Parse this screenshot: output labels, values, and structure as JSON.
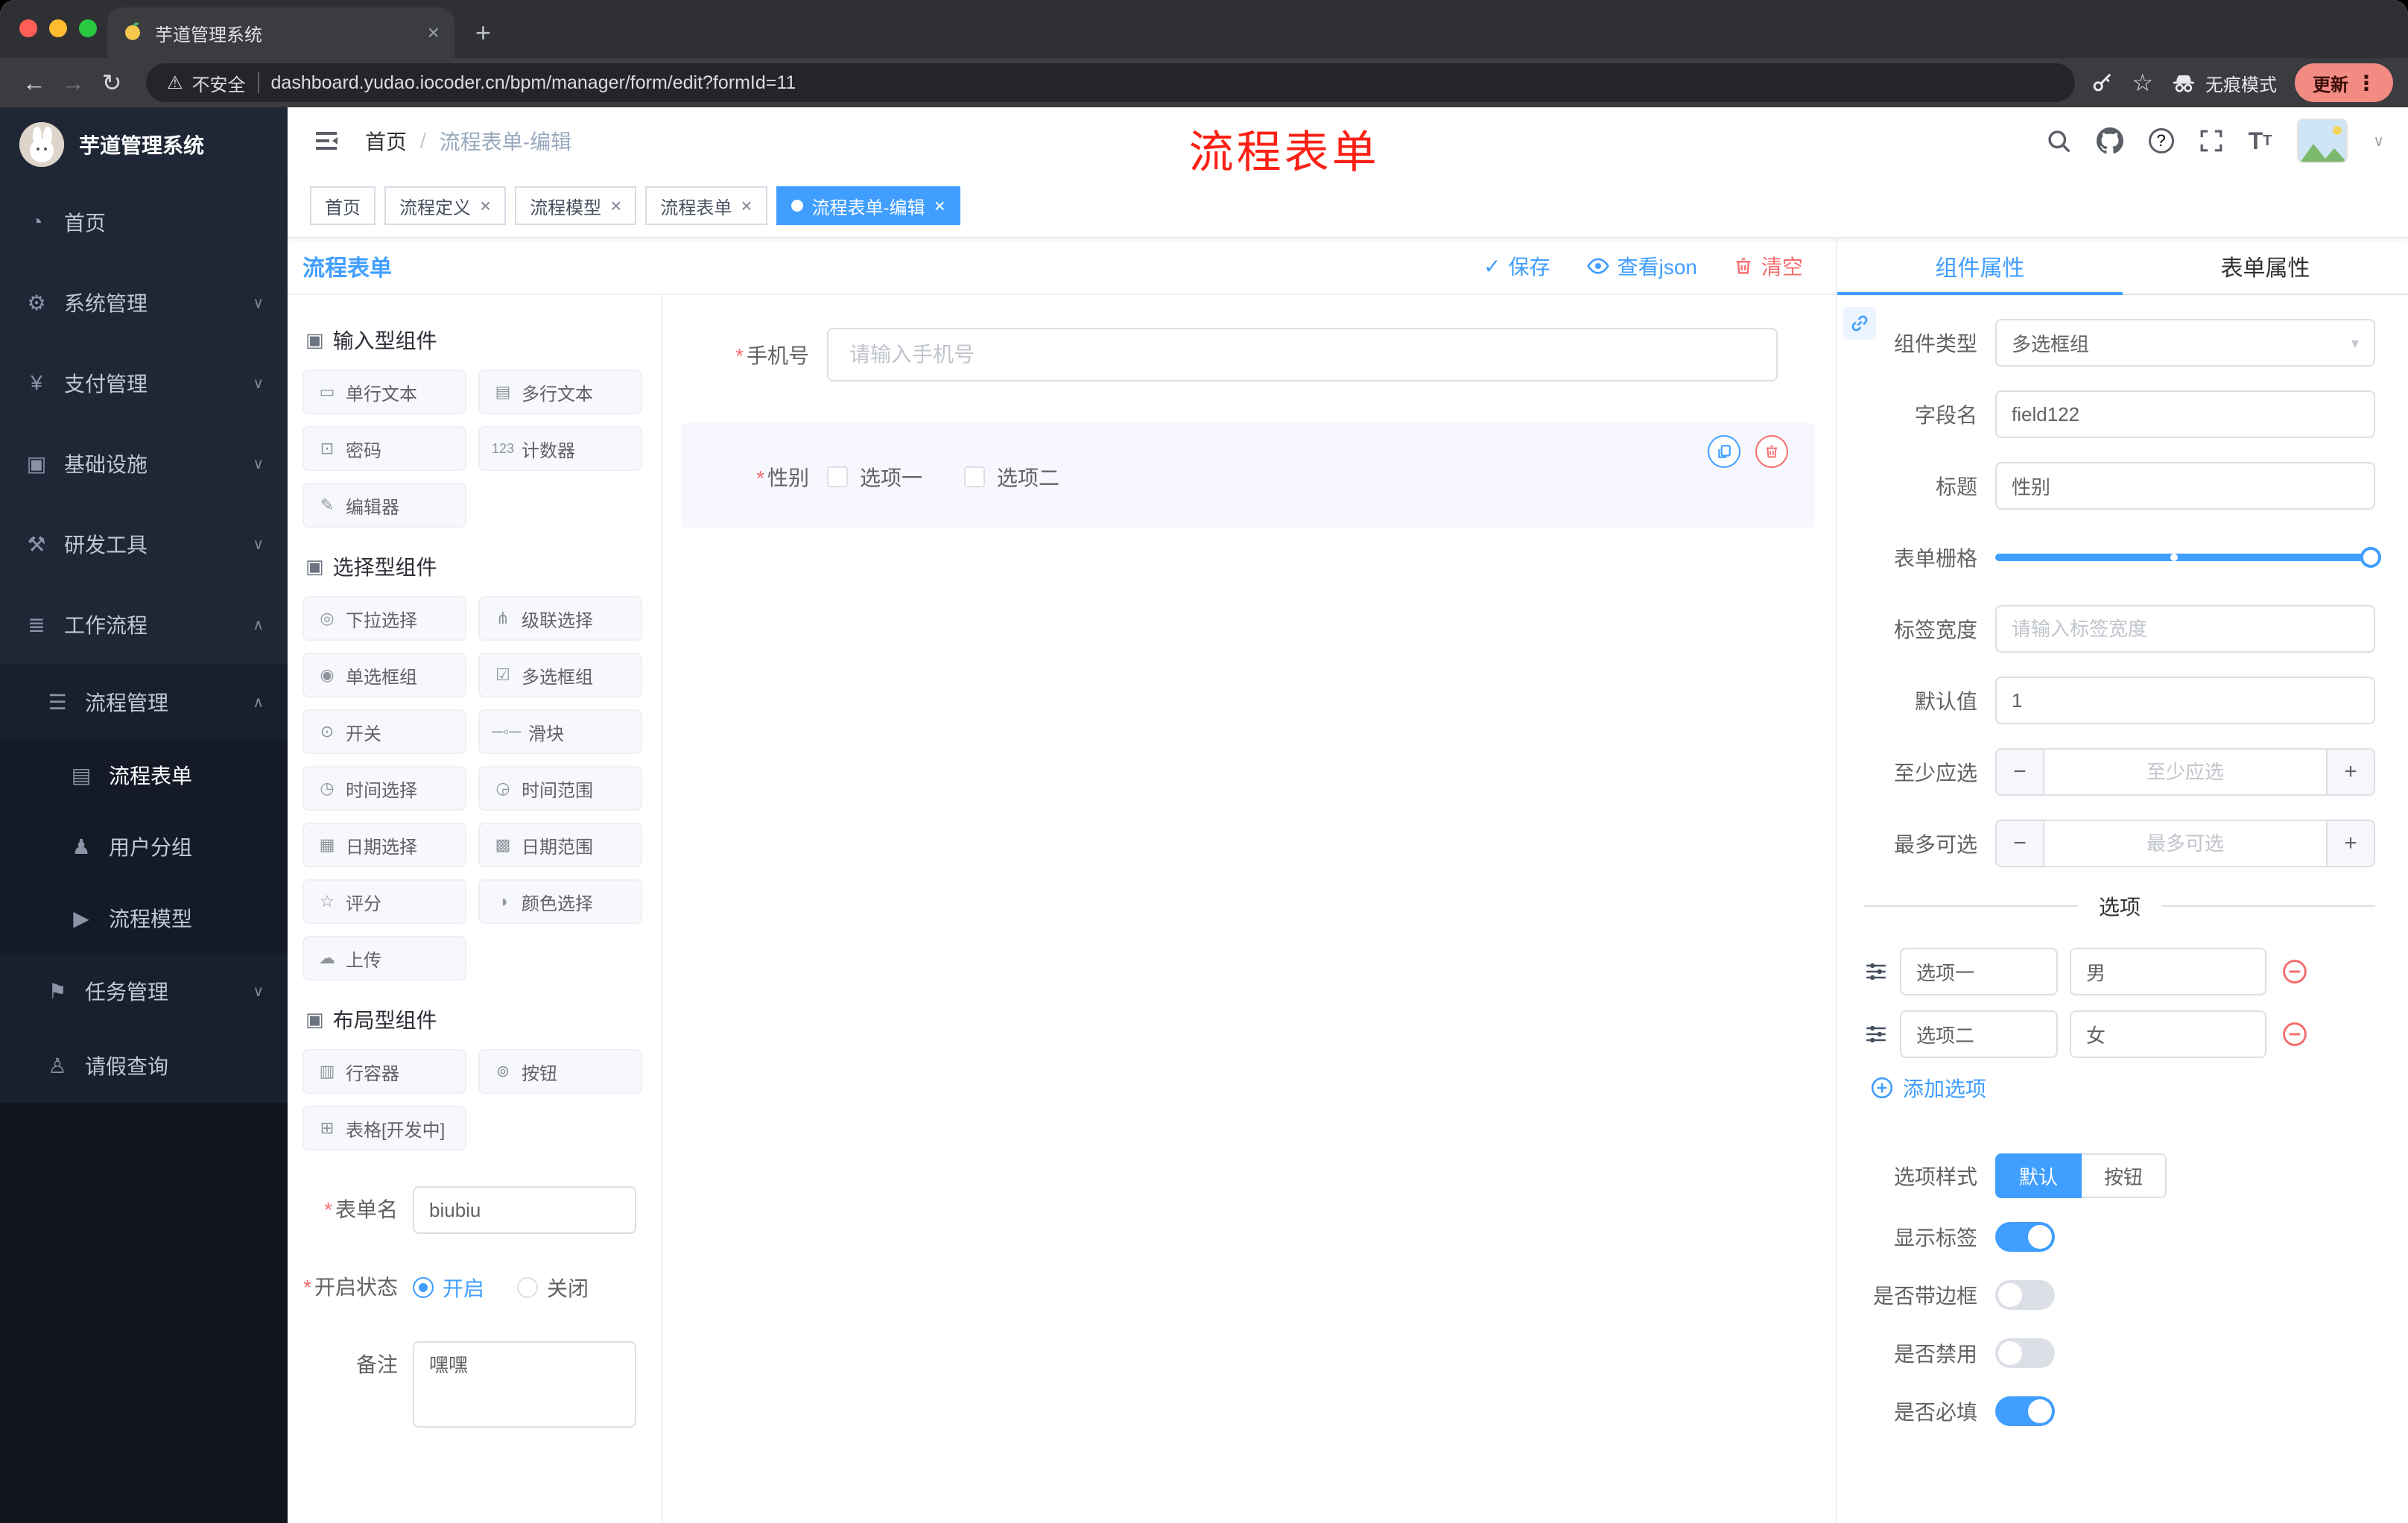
{
  "colors": {
    "accent": "#409eff",
    "danger": "#f56c6c",
    "annotation_red": "#fb2015",
    "sidebar_bg": "#141924",
    "tag_active_bg": "#409eff"
  },
  "icons": {
    "back": "←",
    "forward": "→",
    "reload": "↻",
    "plus": "+",
    "close": "×",
    "warning": "⚠",
    "star": "☆",
    "kebab": "⋮",
    "caret_down": "▾",
    "chevron_down": "∨",
    "chevron_up": "∧",
    "check": "✓",
    "question": "?",
    "t_large": "T",
    "t_small": "T",
    "slash": "/",
    "asterisk": "*",
    "section_cube": "▣",
    "minus": "−"
  },
  "browser": {
    "tab_title": "芋道管理系统",
    "security_label": "不安全",
    "url": "dashboard.yudao.iocoder.cn/bpm/manager/form/edit?formId=11",
    "incognito_label": "无痕模式",
    "update_label": "更新"
  },
  "header": {
    "breadcrumb": {
      "root": "首页",
      "current": "流程表单-编辑"
    },
    "annotation": "流程表单"
  },
  "tags": [
    {
      "label": "首页",
      "closable": false,
      "active": false
    },
    {
      "label": "流程定义",
      "closable": true,
      "active": false
    },
    {
      "label": "流程模型",
      "closable": true,
      "active": false
    },
    {
      "label": "流程表单",
      "closable": true,
      "active": false
    },
    {
      "label": "流程表单-编辑",
      "closable": true,
      "active": true
    }
  ],
  "sidebar": {
    "logo_title": "芋道管理系统",
    "items": [
      {
        "label": "首页",
        "icon": "◔",
        "level": 1
      },
      {
        "label": "系统管理",
        "icon": "⚙",
        "level": 1,
        "chevron": "∨"
      },
      {
        "label": "支付管理",
        "icon": "¥",
        "level": 1,
        "chevron": "∨"
      },
      {
        "label": "基础设施",
        "icon": "▣",
        "level": 1,
        "chevron": "∨"
      },
      {
        "label": "研发工具",
        "icon": "⚒",
        "level": 1,
        "chevron": "∨"
      },
      {
        "label": "工作流程",
        "icon": "≣",
        "level": 1,
        "chevron": "∧"
      },
      {
        "label": "流程管理",
        "icon": "☰",
        "level": 2,
        "chevron": "∧"
      },
      {
        "label": "流程表单",
        "icon": "▤",
        "level": 3,
        "active": true
      },
      {
        "label": "用户分组",
        "icon": "♟",
        "level": 3
      },
      {
        "label": "流程模型",
        "icon": "▶",
        "level": 3
      },
      {
        "label": "任务管理",
        "icon": "⚑",
        "level": 2,
        "chevron": "∨"
      },
      {
        "label": "请假查询",
        "icon": "♙",
        "level": 2
      }
    ]
  },
  "designer": {
    "title": "流程表单",
    "actions": {
      "save": "保存",
      "view_json": "查看json",
      "clear": "清空"
    },
    "palette": {
      "sections": [
        {
          "title": "输入型组件",
          "items": [
            {
              "label": "单行文本",
              "icon": "▭"
            },
            {
              "label": "多行文本",
              "icon": "▤"
            },
            {
              "label": "密码",
              "icon": "⊡"
            },
            {
              "label": "计数器",
              "icon": "123"
            },
            {
              "label": "编辑器",
              "icon": "✎"
            }
          ]
        },
        {
          "title": "选择型组件",
          "items": [
            {
              "label": "下拉选择",
              "icon": "◎"
            },
            {
              "label": "级联选择",
              "icon": "⋔"
            },
            {
              "label": "单选框组",
              "icon": "◉"
            },
            {
              "label": "多选框组",
              "icon": "☑"
            },
            {
              "label": "开关",
              "icon": "⊙"
            },
            {
              "label": "滑块",
              "icon": "─◦─"
            },
            {
              "label": "时间选择",
              "icon": "◷"
            },
            {
              "label": "时间范围",
              "icon": "◶"
            },
            {
              "label": "日期选择",
              "icon": "▦"
            },
            {
              "label": "日期范围",
              "icon": "▩"
            },
            {
              "label": "评分",
              "icon": "☆"
            },
            {
              "label": "颜色选择",
              "icon": "◑"
            },
            {
              "label": "上传",
              "icon": "☁"
            }
          ]
        },
        {
          "title": "布局型组件",
          "items": [
            {
              "label": "行容器",
              "icon": "▥"
            },
            {
              "label": "按钮",
              "icon": "⊚"
            },
            {
              "label": "表格[开发中]",
              "icon": "⊞"
            }
          ]
        }
      ]
    },
    "form_meta": {
      "name_label": "表单名",
      "name_value": "biubiu",
      "status_label": "开启状态",
      "status_on": "开启",
      "status_off": "关闭",
      "remark_label": "备注",
      "remark_value": "嘿嘿"
    },
    "canvas": {
      "phone": {
        "label": "手机号",
        "placeholder": "请输入手机号"
      },
      "gender": {
        "label": "性别",
        "option_one": "选项一",
        "option_two": "选项二"
      }
    }
  },
  "props": {
    "tabs": {
      "component": "组件属性",
      "form": "表单属性"
    },
    "fields": {
      "component_type": {
        "label": "组件类型",
        "value": "多选框组"
      },
      "field_name": {
        "label": "字段名",
        "value": "field122"
      },
      "title": {
        "label": "标题",
        "value": "性别"
      },
      "form_grid": {
        "label": "表单栅格"
      },
      "label_width": {
        "label": "标签宽度",
        "placeholder": "请输入标签宽度"
      },
      "default_value": {
        "label": "默认值",
        "value": "1"
      },
      "min_select": {
        "label": "至少应选",
        "placeholder": "至少应选"
      },
      "max_select": {
        "label": "最多可选",
        "placeholder": "最多可选"
      }
    },
    "options_divider": "选项",
    "options": [
      {
        "label": "选项一",
        "value": "男"
      },
      {
        "label": "选项二",
        "value": "女"
      }
    ],
    "add_option": "添加选项",
    "option_style": {
      "label": "选项样式",
      "default": "默认",
      "button": "按钮"
    },
    "switches": [
      {
        "label": "显示标签",
        "on": true
      },
      {
        "label": "是否带边框",
        "on": false
      },
      {
        "label": "是否禁用",
        "on": false
      },
      {
        "label": "是否必填",
        "on": true
      }
    ]
  }
}
